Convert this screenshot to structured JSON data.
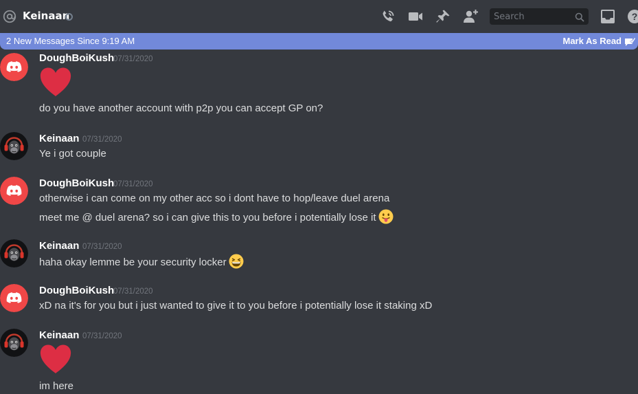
{
  "header": {
    "dm_name": "Keinaan",
    "status": "offline",
    "search_placeholder": "Search",
    "icons": [
      "at-icon",
      "voice-call-icon",
      "video-call-icon",
      "pin-icon",
      "add-friend-icon",
      "search-icon",
      "inbox-icon",
      "help-icon"
    ]
  },
  "new_messages_bar": {
    "text": "2 New Messages Since 9:19 AM",
    "action": "Mark As Read",
    "color": "#7289da"
  },
  "colors": {
    "background": "#36393f",
    "discord_red": "#f04747",
    "timestamp": "#72767d",
    "text": "#dcddde"
  },
  "messages": [
    {
      "author": "DoughBoiKush",
      "timestamp": "07/31/2020",
      "avatar": "discord-default-avatar-red",
      "lines": [
        {
          "type": "emoji-large",
          "emoji": "heart"
        },
        {
          "type": "text",
          "text": "do you have another account with p2p you can accept GP on?"
        }
      ]
    },
    {
      "author": "Keinaan",
      "timestamp": "07/31/2020",
      "avatar": "monkey-headphones-avatar",
      "lines": [
        {
          "type": "text",
          "text": "Ye i got couple"
        }
      ]
    },
    {
      "author": "DoughBoiKush",
      "timestamp": "07/31/2020",
      "avatar": "discord-default-avatar-red",
      "lines": [
        {
          "type": "text",
          "text": "otherwise i can come on my other acc so i dont have to hop/leave duel arena"
        },
        {
          "type": "text",
          "text": "meet me @ duel arena? so i can give this to you before i potentially lose it",
          "emoji": "stuck-out-tongue"
        }
      ]
    },
    {
      "author": "Keinaan",
      "timestamp": "07/31/2020",
      "avatar": "monkey-headphones-avatar",
      "lines": [
        {
          "type": "text",
          "text": "haha okay lemme be your security locker",
          "emoji": "grinning-squinting"
        }
      ]
    },
    {
      "author": "DoughBoiKush",
      "timestamp": "07/31/2020",
      "avatar": "discord-default-avatar-red",
      "lines": [
        {
          "type": "text",
          "text": "xD na it's for you but i just wanted to give it to you before i potentially lose it staking xD"
        }
      ]
    },
    {
      "author": "Keinaan",
      "timestamp": "07/31/2020",
      "avatar": "monkey-headphones-avatar",
      "lines": [
        {
          "type": "emoji-large",
          "emoji": "heart"
        },
        {
          "type": "text",
          "text": "im here"
        }
      ]
    }
  ]
}
